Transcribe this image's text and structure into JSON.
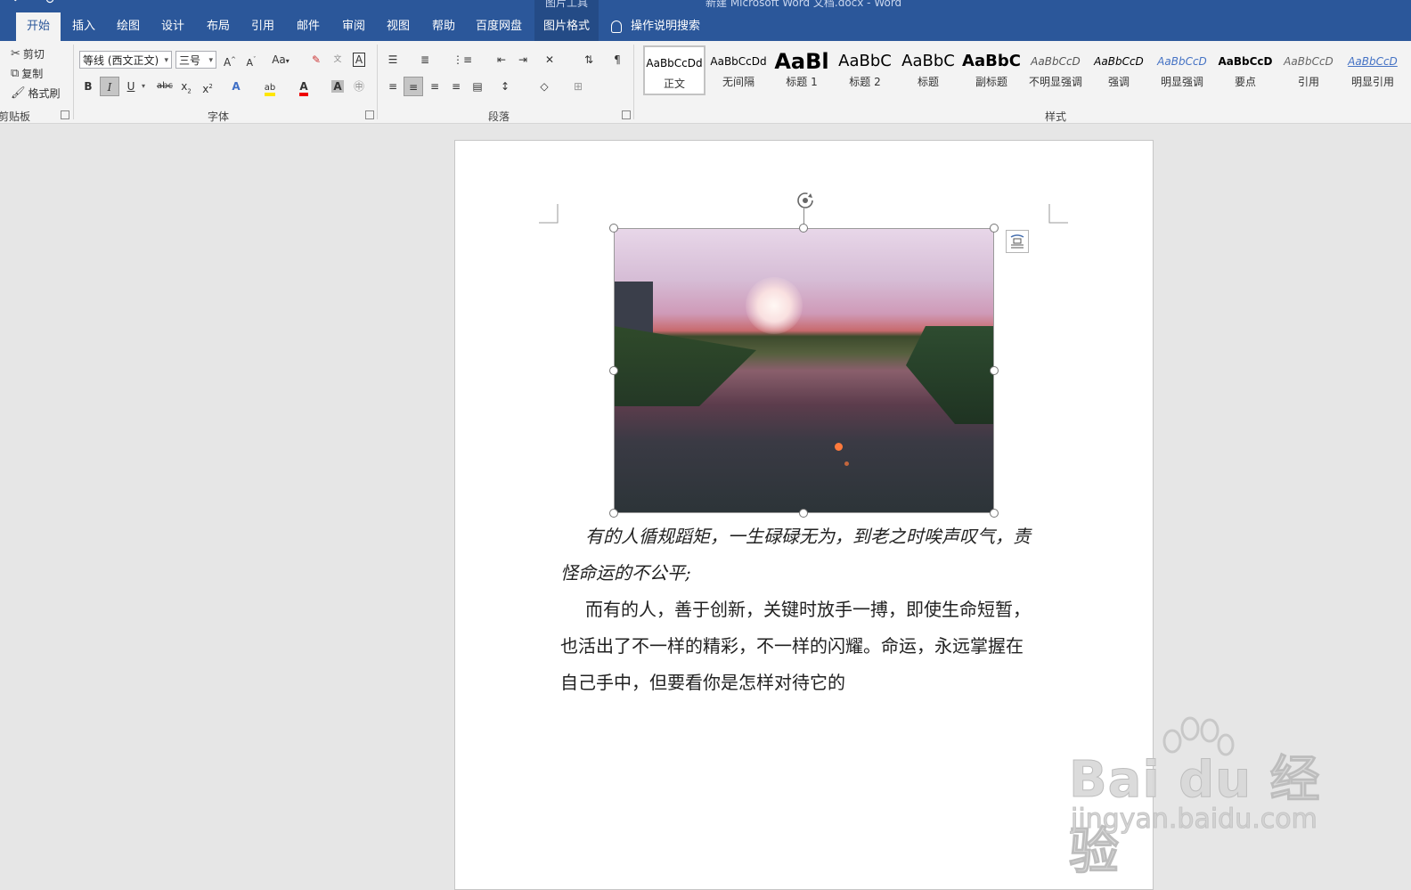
{
  "window": {
    "title": "新建 Microsoft Word 文档.docx - Word",
    "context_group": "图片工具"
  },
  "tabs": [
    {
      "label": "开始",
      "active": true
    },
    {
      "label": "插入"
    },
    {
      "label": "绘图"
    },
    {
      "label": "设计"
    },
    {
      "label": "布局"
    },
    {
      "label": "引用"
    },
    {
      "label": "邮件"
    },
    {
      "label": "审阅"
    },
    {
      "label": "视图"
    },
    {
      "label": "帮助"
    },
    {
      "label": "百度网盘"
    },
    {
      "label": "图片格式",
      "contextual": true
    }
  ],
  "search": {
    "label": "操作说明搜索"
  },
  "clipboard": {
    "cut": "剪切",
    "copy": "复制",
    "format_painter": "格式刷",
    "label": "剪贴板"
  },
  "font": {
    "name": "等线 (西文正文)",
    "size": "三号",
    "grow": "A",
    "shrink": "A",
    "case": "Aa",
    "bold": "B",
    "italic": "I",
    "underline": "U",
    "strike": "abc",
    "subscript": "x",
    "superscript": "x",
    "label": "字体"
  },
  "paragraph": {
    "label": "段落"
  },
  "styles": {
    "label": "样式",
    "items": [
      {
        "sample": "AaBbCcDd",
        "name": "正文"
      },
      {
        "sample": "AaBbCcDd",
        "name": "无间隔"
      },
      {
        "sample": "AaBl",
        "name": "标题 1"
      },
      {
        "sample": "AaBbC",
        "name": "标题 2"
      },
      {
        "sample": "AaBbC",
        "name": "标题"
      },
      {
        "sample": "AaBbC",
        "name": "副标题"
      },
      {
        "sample": "AaBbCcD",
        "name": "不明显强调"
      },
      {
        "sample": "AaBbCcD",
        "name": "强调"
      },
      {
        "sample": "AaBbCcD",
        "name": "明显强调"
      },
      {
        "sample": "AaBbCcD",
        "name": "要点"
      },
      {
        "sample": "AaBbCcD",
        "name": "引用"
      },
      {
        "sample": "AaBbCcD",
        "name": "明显引用"
      }
    ]
  },
  "document": {
    "para1_line1": "有的人循规蹈矩，一生碌碌无为，到老之时唉声叹气，责",
    "para1_line2": "怪命运的不公平;",
    "para2_line1": "而有的人，善于创新，关键时放手一搏，即使生命短暂，",
    "para2_line2": "也活出了不一样的精彩，不一样的闪耀。命运，永远掌握在",
    "para2_line3": "自己手中，但要看你是怎样对待它的"
  },
  "watermark": {
    "main": "Bai du 经验",
    "sub": "jingyan.baidu.com"
  },
  "colors": {
    "titlebar": "#2b579a",
    "ribbon": "#f3f3f3",
    "canvas": "#e6e6e6"
  }
}
